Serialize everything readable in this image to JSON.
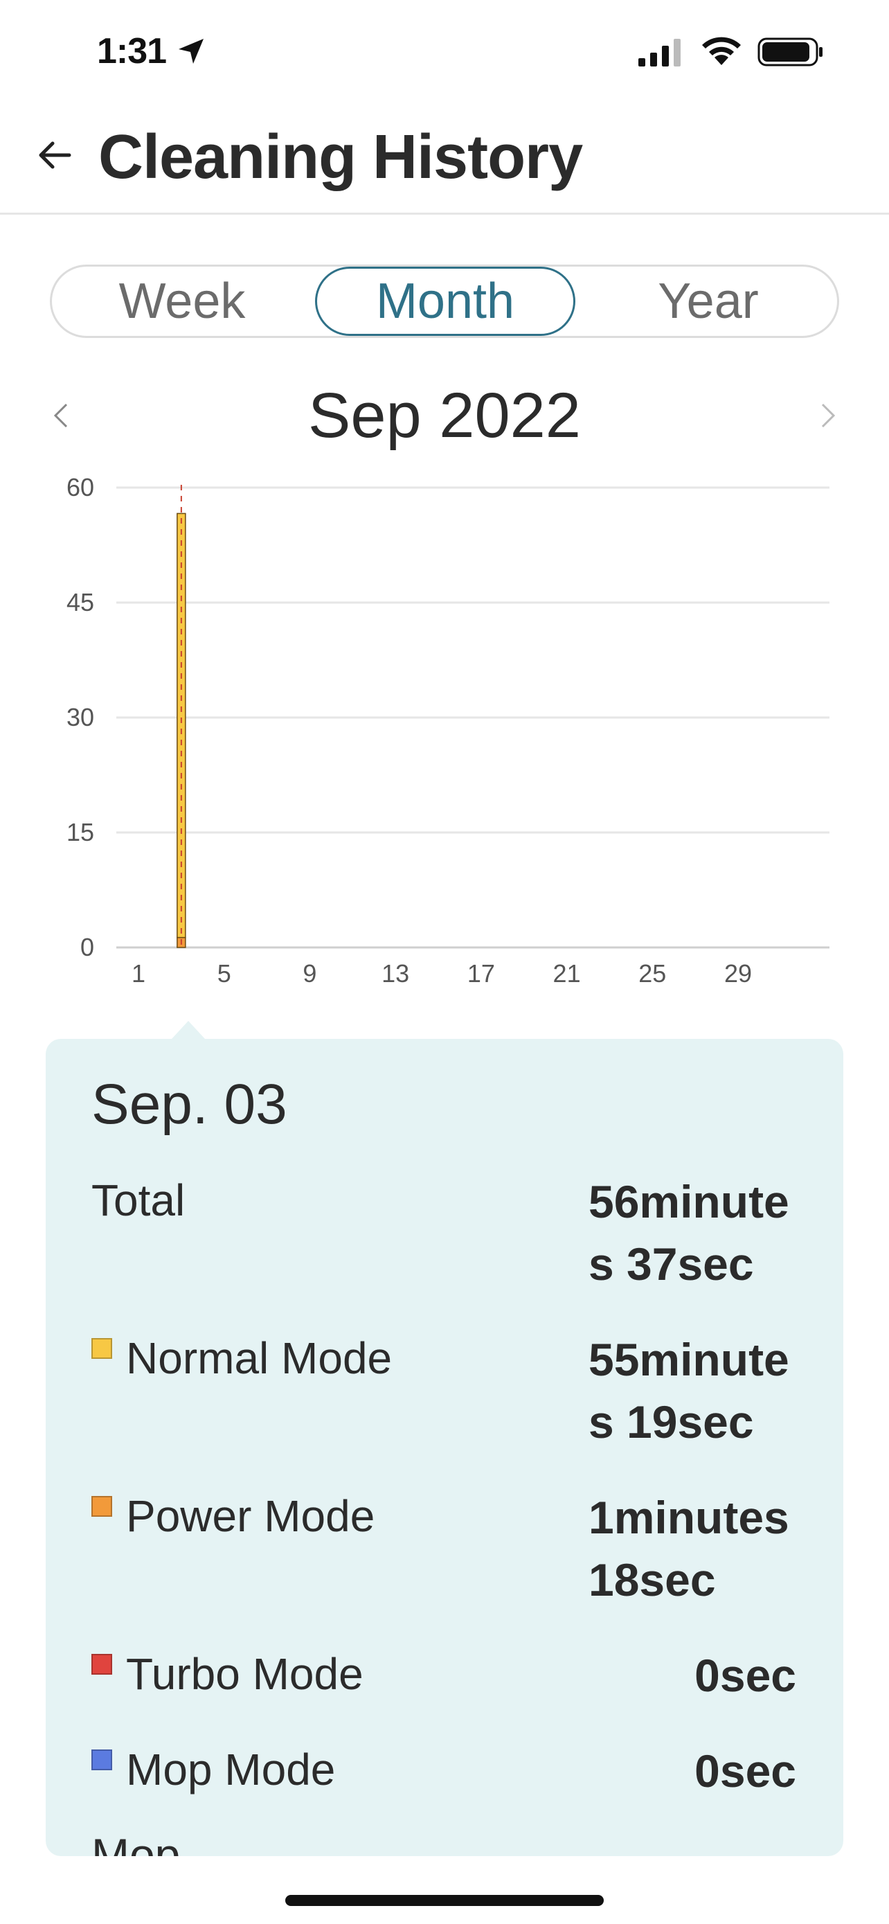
{
  "status_bar": {
    "time": "1:31"
  },
  "header": {
    "title": "Cleaning History"
  },
  "tabs": [
    {
      "label": "Week",
      "selected": false
    },
    {
      "label": "Month",
      "selected": true
    },
    {
      "label": "Year",
      "selected": false
    }
  ],
  "period": {
    "label": "Sep 2022"
  },
  "chart_data": {
    "type": "bar",
    "x_ticks": [
      "1",
      "5",
      "9",
      "13",
      "17",
      "21",
      "25",
      "29"
    ],
    "y_ticks": [
      "0",
      "15",
      "30",
      "45",
      "60"
    ],
    "ylim": [
      0,
      60
    ],
    "xlim": [
      1,
      30
    ],
    "grid": true,
    "selected_day": 3,
    "bars": [
      {
        "day": 3,
        "series": [
          {
            "name": "Normal Mode",
            "value": 55.32,
            "color": "#f7c844"
          },
          {
            "name": "Power Mode",
            "value": 1.3,
            "color": "#f29a3a"
          }
        ]
      }
    ]
  },
  "detail": {
    "date": "Sep. 03",
    "total_label": "Total",
    "total_value": "56minutes 37sec",
    "modes": [
      {
        "label": "Normal Mode",
        "value": "55minutes 19sec",
        "color": "#f7c844"
      },
      {
        "label": "Power Mode",
        "value": "1minutes 18sec",
        "color": "#f29a3a"
      },
      {
        "label": "Turbo Mode",
        "value": "0sec",
        "color": "#e0443e"
      },
      {
        "label": "Mop Mode",
        "value": "0sec",
        "color": "#5b7be0"
      }
    ],
    "cut_off_text": "Mop ..."
  },
  "colors": {
    "accent": "#2f7188",
    "card_bg": "#e5f3f4"
  }
}
